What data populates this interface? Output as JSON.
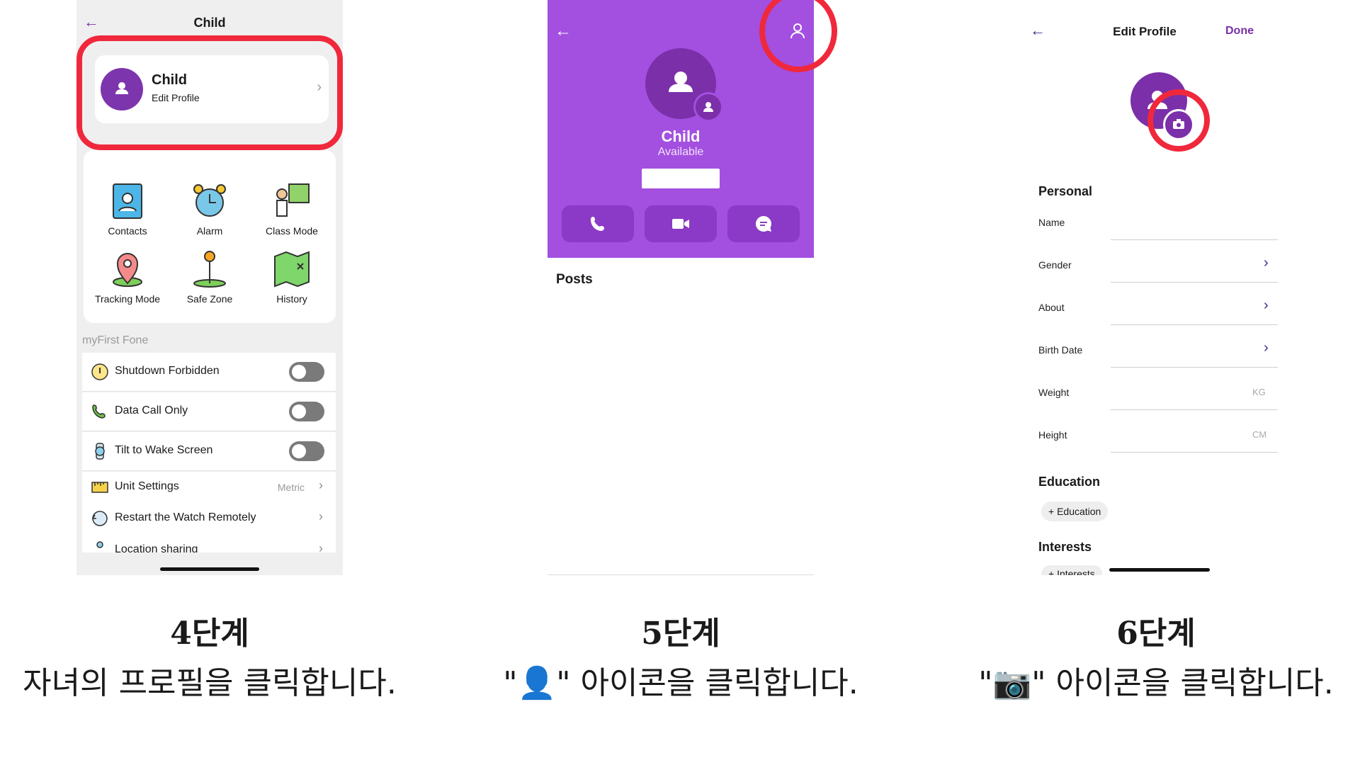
{
  "screen1": {
    "title": "Child",
    "profile": {
      "name": "Child",
      "sub": "Edit Profile"
    },
    "grid": [
      {
        "label": "Contacts"
      },
      {
        "label": "Alarm"
      },
      {
        "label": "Class Mode"
      },
      {
        "label": "Tracking Mode"
      },
      {
        "label": "Safe Zone"
      },
      {
        "label": "History"
      }
    ],
    "section_label": "myFirst Fone",
    "settings": [
      {
        "label": "Shutdown Forbidden"
      },
      {
        "label": "Data Call Only"
      },
      {
        "label": "Tilt to Wake Screen"
      },
      {
        "label": "Unit Settings",
        "value": "Metric"
      },
      {
        "label": "Restart the Watch Remotely"
      },
      {
        "label": "Location sharing"
      }
    ]
  },
  "screen2": {
    "name": "Child",
    "status": "Available",
    "posts_label": "Posts",
    "accent": "#a34fe0"
  },
  "screen3": {
    "title": "Edit Profile",
    "done": "Done",
    "personal_title": "Personal",
    "fields": [
      {
        "label": "Name"
      },
      {
        "label": "Gender"
      },
      {
        "label": "About"
      },
      {
        "label": "Birth Date"
      },
      {
        "label": "Weight",
        "unit": "KG"
      },
      {
        "label": "Height",
        "unit": "CM"
      }
    ],
    "education_title": "Education",
    "education_chip": "+ Education",
    "interests_title": "Interests",
    "interests_chip": "+ Interests"
  },
  "captions": [
    {
      "step": "4단계",
      "desc": "자녀의 프로필을 클릭합니다."
    },
    {
      "step": "5단계",
      "desc": "\"👤\" 아이콘을 클릭합니다."
    },
    {
      "step": "6단계",
      "desc": "\"📷\" 아이콘을 클릭합니다."
    }
  ],
  "colors": {
    "highlight": "#f0283c",
    "brand": "#7d35ad"
  }
}
